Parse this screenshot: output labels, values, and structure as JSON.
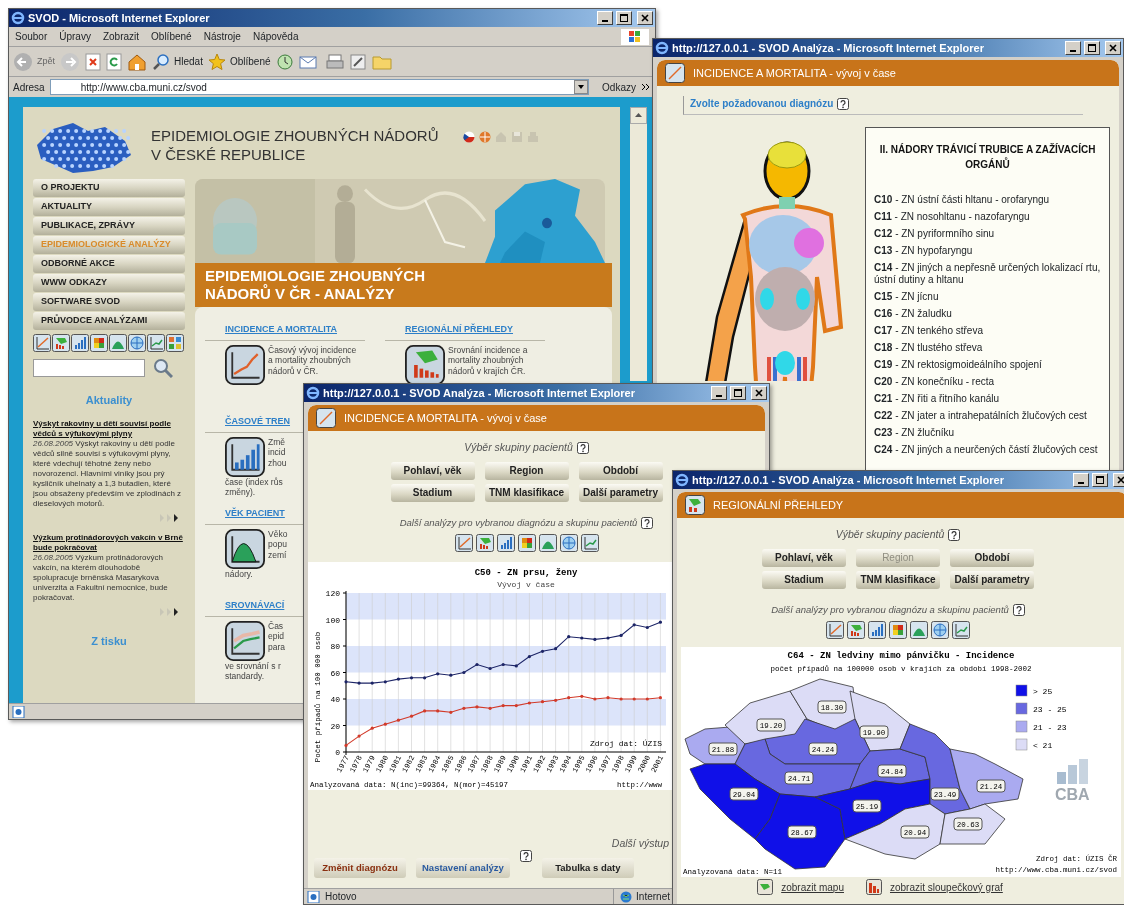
{
  "portal_window": {
    "title": "SVOD - Microsoft Internet Explorer",
    "menu": [
      "Soubor",
      "Úpravy",
      "Zobrazit",
      "Oblíbené",
      "Nástroje",
      "Nápověda"
    ],
    "toolbar": {
      "back": "Zpět",
      "search": "Hledat",
      "favorites": "Oblíbené"
    },
    "address_label": "Adresa",
    "address": "http://www.cba.muni.cz/svod",
    "links_label": "Odkazy",
    "site_title": [
      "EPIDEMIOLOGIE ZHOUBNÝCH NÁDORŮ",
      "V ČESKÉ REPUBLICE"
    ],
    "nav": [
      {
        "label": "O PROJEKTU",
        "selected": false
      },
      {
        "label": "AKTUALITY",
        "selected": false
      },
      {
        "label": "PUBLIKACE, ZPRÁVY",
        "selected": false
      },
      {
        "label": "EPIDEMIOLOGICKÉ ANALÝZY",
        "selected": true
      },
      {
        "label": "ODBORNÉ AKCE",
        "selected": false
      },
      {
        "label": "WWW ODKAZY",
        "selected": false
      },
      {
        "label": "SOFTWARE SVOD",
        "selected": false
      },
      {
        "label": "PRŮVODCE ANALÝZAMI",
        "selected": false
      }
    ],
    "banner": [
      "EPIDEMIOLOGIE ZHOUBNÝCH",
      "NÁDORŮ V ČR - ANALÝZY"
    ],
    "section_columns": [
      [
        {
          "title": "INCIDENCE A MORTALITA",
          "lines": [
            "Časový vývoj incidence",
            "a mortality zhoubných",
            "nádorů v ČR."
          ]
        },
        {
          "title": "ČASOVÉ TREN",
          "lines": [
            "Změ",
            "incid",
            "zhou",
            "čase (index růs",
            "změny)."
          ]
        },
        {
          "title": "VĚK PACIENT",
          "lines": [
            "Věko",
            "popu",
            "zemí",
            "nádory."
          ]
        },
        {
          "title": "SROVNÁVACÍ",
          "lines": [
            "Čas",
            "epid",
            "para",
            "ve srovnání s r",
            "standardy."
          ]
        }
      ],
      [
        {
          "title": "REGIONÁLNÍ PŘEHLEDY",
          "lines": [
            "Srovnání incidence a",
            "mortality zhoubných",
            "nádorů v krajích ČR."
          ]
        }
      ]
    ],
    "news_heading": "Aktuality",
    "news": [
      {
        "title": "Výskyt rakoviny u dětí souvisí podle vědců s výfukovými plyny",
        "date": "26.08.2005",
        "text": "Výskyt rakoviny u dětí podle vědců silně souvisí s výfukovými plyny, které vdechují těhotné ženy nebo novorozenci. Hlavními viníky jsou prý kysličník uhelnatý a 1,3 butadien, které jsou obsaženy především ve zplodinách z dieselových motorů."
      },
      {
        "title": "Výzkum protinádorových vakcín v Brně bude pokračovat",
        "date": "26.08.2005",
        "text": "Výzkum protinádorových vakcín, na kterém dlouhodobě spolupracuje brněnská Masarykova univerzita a Fakultní nemocnice, bude pokračovat."
      }
    ],
    "press_heading": "Z tisku"
  },
  "diagnosis_window": {
    "title": "http://127.0.0.1 - SVOD Analýza - Microsoft Internet Explorer",
    "header": "INCIDENCE A MORTALITA - vývoj v čase",
    "prompt": "Zvolte požadovanou diagnózu",
    "group_title": "II. NÁDORY TRÁVICÍ TRUBICE A ZAŽÍVACÍCH ORGÁNŮ",
    "diagnoses": [
      "**C10** - ZN ústní části hltanu - orofaryngu",
      "**C11** - ZN nosohltanu - nazofaryngu",
      "**C12** - ZN pyriformního sinu",
      "**C13** - ZN hypofaryngu",
      "**C14** - ZN jiných a nepřesně určených lokalizací rtu, ústní dutiny a hltanu",
      "**C15** - ZN jícnu",
      "**C16** - ZN žaludku",
      "**C17** - ZN tenkého střeva",
      "**C18** - ZN tlustého střeva",
      "**C19** - ZN rektosigmoideálního spojení",
      "**C20** - ZN konečníku - recta",
      "**C21** - ZN řiti a řitního kanálu",
      "**C22** - ZN jater a intrahepatálních žlučových cest",
      "**C23** - ZN žlučníku",
      "**C24** - ZN jiných a neurčených částí žlučových cest"
    ]
  },
  "trend_window": {
    "title": "http://127.0.0.1 - SVOD Analýza - Microsoft Internet Explorer",
    "header": "INCIDENCE A MORTALITA - vývoj v čase",
    "group_prompt": "Výběr skupiny pacientů",
    "group_buttons": [
      {
        "label": "Pohlaví, věk",
        "disabled": false
      },
      {
        "label": "Region",
        "disabled": false
      },
      {
        "label": "Období",
        "disabled": false
      },
      {
        "label": "Stadium",
        "disabled": false
      },
      {
        "label": "TNM klasifikace",
        "disabled": false
      },
      {
        "label": "Další parametry",
        "disabled": false
      }
    ],
    "analyses_prompt": "Další analýzy pro vybranou diagnózu a skupinu pacientů",
    "chart_data": {
      "type": "line",
      "title": "C50 - ZN prsu, ženy",
      "ylabel": "Počet případů na 100 000 osob",
      "categories": [
        "1977",
        "1978",
        "1979",
        "1980",
        "1981",
        "1982",
        "1983",
        "1984",
        "1985",
        "1986",
        "1987",
        "1988",
        "1989",
        "1990",
        "1991",
        "1992",
        "1993",
        "1994",
        "1995",
        "1996",
        "1997",
        "1998",
        "1999",
        "2000",
        "2001"
      ],
      "series": [
        {
          "color": "#1c2466",
          "values": [
            53,
            52,
            52,
            53,
            55,
            56,
            56,
            59,
            58,
            60,
            66,
            63,
            66,
            65,
            72,
            76,
            78,
            87,
            86,
            85,
            86,
            88,
            96,
            94,
            98
          ]
        },
        {
          "color": "#d23a2a",
          "values": [
            5,
            12,
            18,
            21,
            24,
            27,
            31,
            31,
            30,
            33,
            34,
            33,
            35,
            35,
            37,
            38,
            39,
            41,
            42,
            40,
            41,
            40,
            40,
            40,
            41
          ]
        }
      ],
      "ylim": [
        0,
        120
      ],
      "yticks": [
        0,
        20,
        40,
        60,
        80,
        100,
        120
      ],
      "grid": true
    },
    "chart_subtitle": "Vývoj v čase",
    "source": "Zdroj dat: ÚZIS",
    "footer": "Analyzovaná data: N(inc)=99364, N(mor)=45197",
    "url": "http://www",
    "outputs_label": "Další výstup",
    "actions": [
      "Změnit diagnózu",
      "Nastavení analýzy",
      "Tabulka s daty"
    ],
    "status": "Hotovo",
    "zone": "Internet"
  },
  "regional_window": {
    "title": "http://127.0.0.1 - SVOD Analýza - Microsoft Internet Explorer",
    "header": "REGIONÁLNÍ PŘEHLEDY",
    "group_prompt": "Výběr skupiny pacientů",
    "group_buttons": [
      {
        "label": "Pohlaví, věk",
        "disabled": false
      },
      {
        "label": "Region",
        "disabled": true
      },
      {
        "label": "Období",
        "disabled": false
      },
      {
        "label": "Stadium",
        "disabled": false
      },
      {
        "label": "TNM klasifikace",
        "disabled": false
      },
      {
        "label": "Další parametry",
        "disabled": false
      }
    ],
    "analyses_prompt": "Další analýzy pro vybranou diagnózu a skupinu pacientů",
    "map": {
      "title": "C64 - ZN ledviny mimo pánvičku - Incidence",
      "subtitle": "počet případů na 100000 osob v krajích za období 1998-2002",
      "regions": [
        {
          "value": "21.88",
          "color": "#aaaaf0"
        },
        {
          "value": "19.20",
          "color": "#dcdcf6"
        },
        {
          "value": "18.30",
          "color": "#dcdcf6"
        },
        {
          "value": "19.90",
          "color": "#dcdcf6"
        },
        {
          "value": "24.24",
          "color": "#6868e0"
        },
        {
          "value": "24.71",
          "color": "#6868e0"
        },
        {
          "value": "29.04",
          "color": "#1010e8"
        },
        {
          "value": "28.67",
          "color": "#1010e8"
        },
        {
          "value": "24.84",
          "color": "#6868e0"
        },
        {
          "value": "25.19",
          "color": "#1010e8"
        },
        {
          "value": "23.49",
          "color": "#6868e0"
        },
        {
          "value": "21.24",
          "color": "#aaaaf0"
        },
        {
          "value": "20.94",
          "color": "#dcdcf6"
        },
        {
          "value": "20.63",
          "color": "#dcdcf6"
        }
      ],
      "legend": [
        {
          "label": "> 25",
          "color": "#1010e8"
        },
        {
          "label": "23 - 25",
          "color": "#6868e0"
        },
        {
          "label": "21 - 23",
          "color": "#aaaaf0"
        },
        {
          "label": "< 21",
          "color": "#dcdcf6"
        }
      ],
      "logo": "CBA",
      "footer": "Analyzovaná data: N=11",
      "source": "Zdroj dat: ÚZIS ČR",
      "url": "http://www.cba.muni.cz/svod"
    },
    "links": [
      "zobrazit mapu",
      "zobrazit sloupečkový graf"
    ]
  }
}
